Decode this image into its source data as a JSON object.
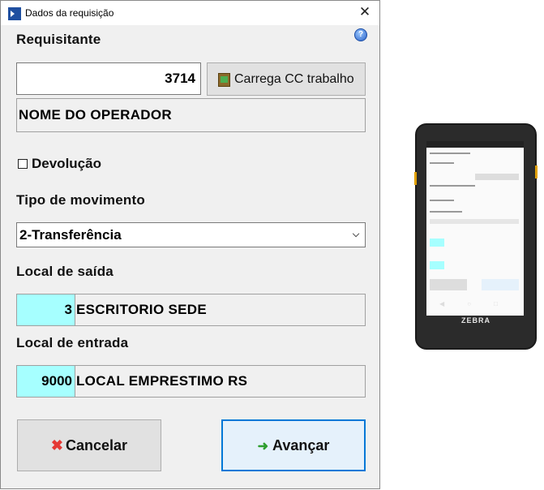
{
  "dialog": {
    "title": "Dados da requisição",
    "close_glyph": "✕",
    "help_icon": "help-icon"
  },
  "requisitante": {
    "label": "Requisitante",
    "code": "3714",
    "load_button": "Carrega CC trabalho",
    "operator_name": "NOME DO OPERADOR"
  },
  "devolucao": {
    "label": "Devolução",
    "checked": false
  },
  "movimento": {
    "label": "Tipo de movimento",
    "selected": "2-Transferência"
  },
  "saida": {
    "label": "Local de saída",
    "code": "3",
    "name": "ESCRITORIO SEDE"
  },
  "entrada": {
    "label": "Local de entrada",
    "code": "9000",
    "name": "LOCAL EMPRESTIMO RS"
  },
  "buttons": {
    "cancel": "Cancelar",
    "next": "Avançar"
  },
  "phone": {
    "brand": "ZEBRA"
  },
  "colors": {
    "code_background": "#a6ffff",
    "primary_border": "#0078d7"
  }
}
